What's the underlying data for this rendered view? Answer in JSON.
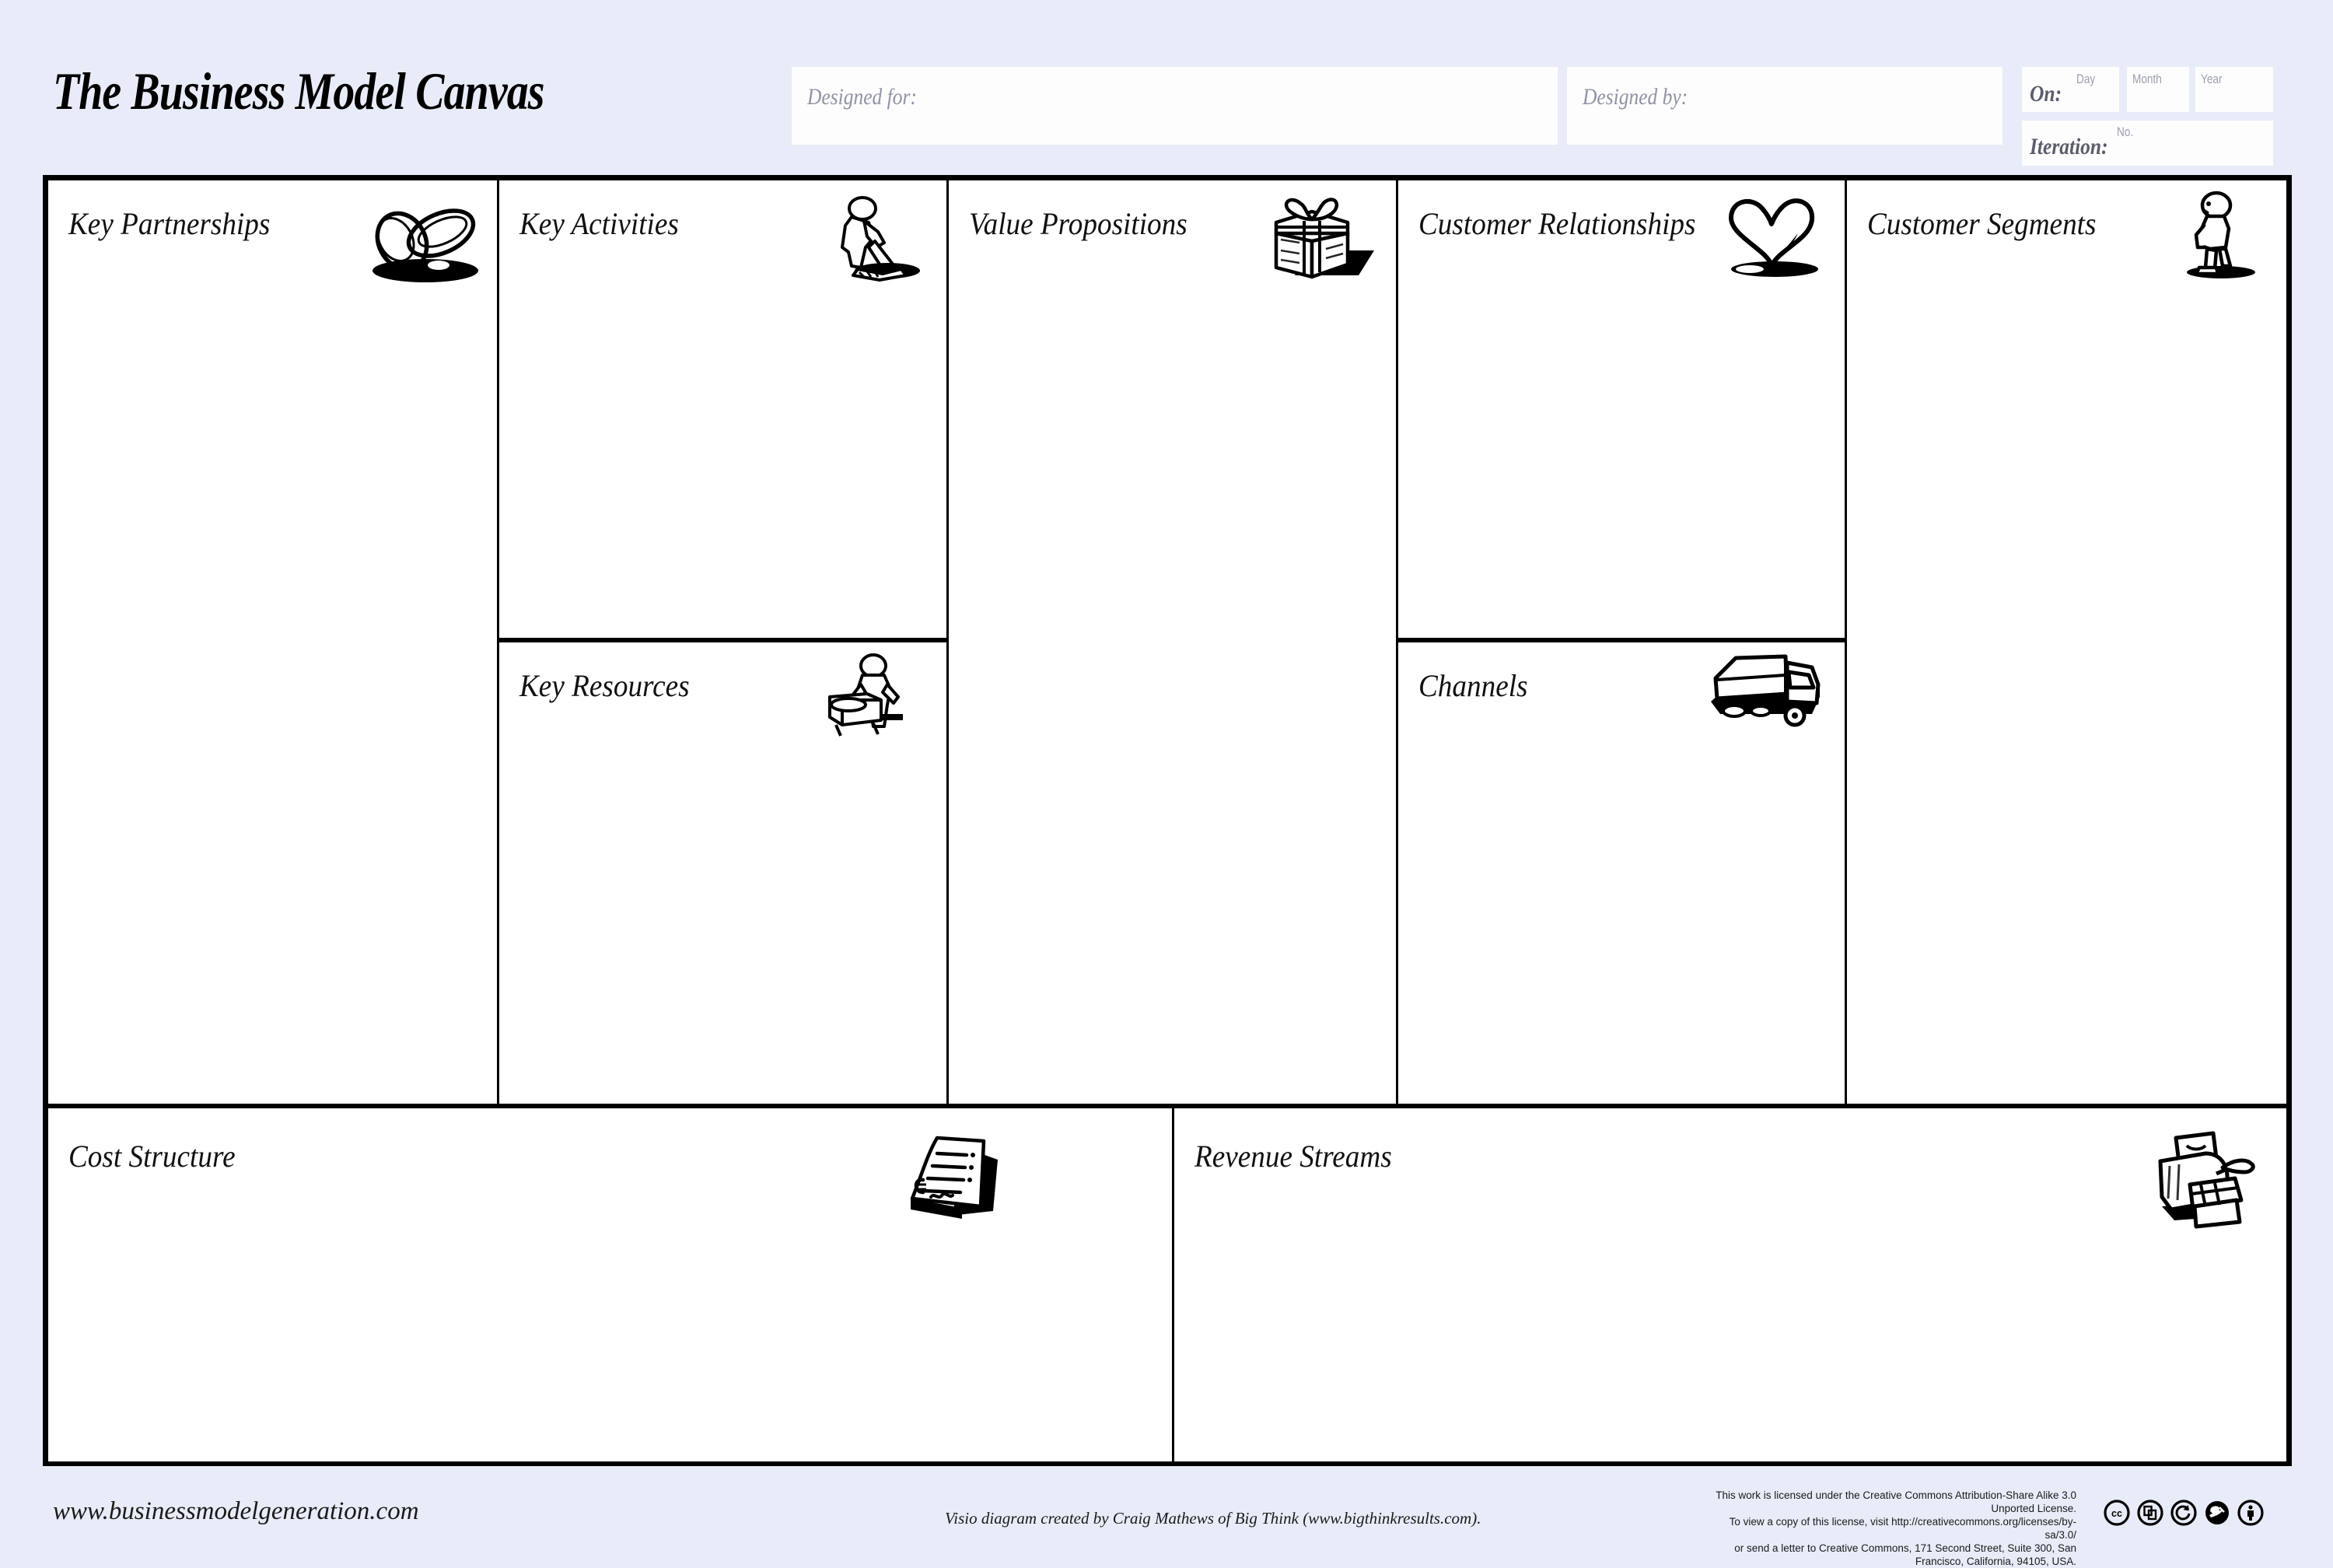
{
  "header": {
    "title": "The Business Model Canvas",
    "designed_for_label": "Designed for:",
    "designed_by_label": "Designed by:",
    "on_label": "On:",
    "day_label": "Day",
    "month_label": "Month",
    "year_label": "Year",
    "iteration_label": "Iteration:",
    "no_label": "No.",
    "designed_for_value": "",
    "designed_by_value": "",
    "day_value": "",
    "month_value": "",
    "year_value": "",
    "iteration_value": ""
  },
  "blocks": [
    {
      "key": "key_partnerships",
      "title": "Key Partnerships",
      "icon": "interlocking-rings-icon",
      "content": ""
    },
    {
      "key": "key_activities",
      "title": "Key Activities",
      "icon": "worker-digging-icon",
      "content": ""
    },
    {
      "key": "key_resources",
      "title": "Key Resources",
      "icon": "worker-pallet-icon",
      "content": ""
    },
    {
      "key": "value_propositions",
      "title": "Value Propositions",
      "icon": "gift-box-icon",
      "content": ""
    },
    {
      "key": "customer_relationships",
      "title": "Customer Relationships",
      "icon": "heart-icon",
      "content": ""
    },
    {
      "key": "channels",
      "title": "Channels",
      "icon": "delivery-truck-icon",
      "content": ""
    },
    {
      "key": "customer_segments",
      "title": "Customer Segments",
      "icon": "standing-person-icon",
      "content": ""
    },
    {
      "key": "cost_structure",
      "title": "Cost Structure",
      "icon": "invoice-page-icon",
      "content": ""
    },
    {
      "key": "revenue_streams",
      "title": "Revenue Streams",
      "icon": "cash-register-icon",
      "content": ""
    }
  ],
  "footer": {
    "site_url": "www.businessmodelgeneration.com",
    "credit": "Visio diagram created by Craig Mathews of Big Think (www.bigthinkresults.com).",
    "license_line1": "This work is licensed under the Creative Commons Attribution-Share Alike 3.0 Unported License.",
    "license_line2": "To view a copy of this license, visit http://creativecommons.org/licenses/by-sa/3.0/",
    "license_line3": "or send a letter to Creative Commons, 171 Second Street, Suite 300, San Francisco, California, 94105, USA.",
    "cc_badges": [
      "cc-logo-icon",
      "cc-share-icon",
      "cc-share-alike-icon",
      "cc-remix-icon",
      "cc-attribution-icon"
    ]
  },
  "colors": {
    "page_background": "#e8ecf8",
    "canvas_background": "#ffffff",
    "border": "#000000",
    "label_grey": "#8f93a3"
  }
}
